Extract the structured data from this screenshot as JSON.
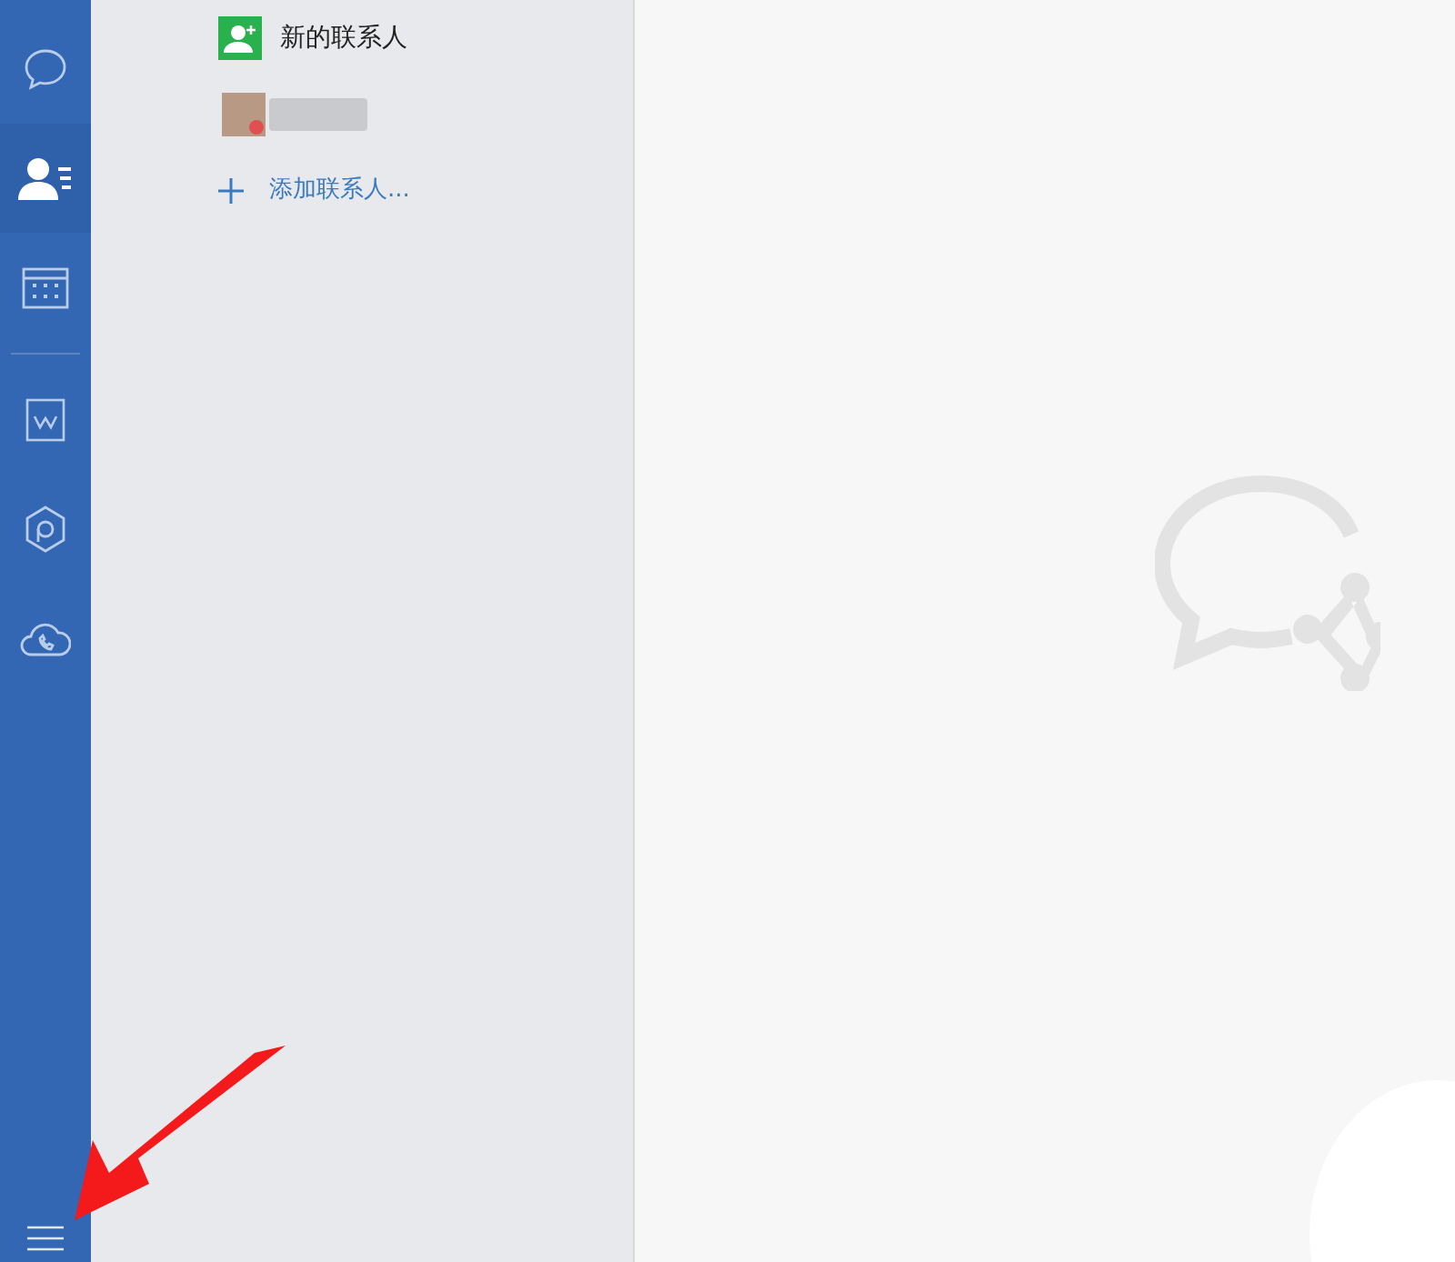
{
  "sidebar": {
    "items": [
      {
        "kind": "chat",
        "selected": false
      },
      {
        "kind": "contacts",
        "selected": true
      },
      {
        "kind": "calendar",
        "selected": false
      }
    ],
    "more_items": [
      {
        "kind": "document",
        "selected": false
      },
      {
        "kind": "workbench",
        "selected": false
      },
      {
        "kind": "cloud",
        "selected": false
      }
    ]
  },
  "contacts": {
    "items": [
      {
        "kind": "new",
        "label": "新的联系人"
      },
      {
        "kind": "blurred"
      },
      {
        "kind": "add",
        "label": "添加联系人..."
      }
    ]
  },
  "annotation": {
    "kind": "arrow"
  }
}
